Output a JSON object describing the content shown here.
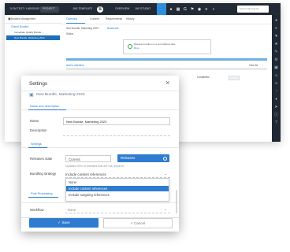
{
  "app": {
    "topbar": {
      "project_selector": "JLCM TEST / LABS/1100",
      "menu_label": "PROJECT",
      "env_label": "JAS-TEMPLATE",
      "user_initial": "S",
      "tab_overview": "OVERVIEW",
      "tab_jam": "JAS STUDIO",
      "search_placeholder": "Search all projects"
    },
    "sidebar": {
      "title": "Bundles Management",
      "section": "ClientA Bundles",
      "items": [
        {
          "label": "Immediate Quality Bundle ..."
        },
        {
          "label": "New Bundle, Marketing 2023"
        }
      ]
    },
    "content": {
      "tabs": [
        "Overview",
        "Content",
        "Requirements",
        "History"
      ],
      "breadcrumb": "New Bundle, Marketing 2023",
      "breadcrumb_action": "Bookmark",
      "status_label": "Status",
      "info_line1": "Releases bundle is in a non-finalized state",
      "info_line2": "More",
      "add_label": "Add to selection",
      "row_label": "Target Product",
      "row_status": "Completed",
      "view_all": "View All"
    }
  },
  "dialog": {
    "title": "Settings",
    "subtitle": "New Bundle, Marketing 2023",
    "section_name": "Name and description",
    "name_label": "Name",
    "name_value": "New Bundle, Marketing 2023",
    "description_label": "Description",
    "section_settings": "Settings",
    "releases_state_label": "Releases state",
    "releases_option_current": "Current",
    "releases_option_releases": "Releases",
    "releases_hint": "Updated 40% of releases that are not required",
    "bundling_label": "Bundling strategy",
    "bundling_value": "Include content references",
    "bundling_options": [
      {
        "label": "None"
      },
      {
        "label": "Include content references"
      },
      {
        "label": "Include outgoing references"
      }
    ],
    "section_post_processing": "Post Processing",
    "workflow_label": "Workflow",
    "workflow_value": "- None -",
    "save_label": "Save",
    "cancel_label": "Cancel"
  }
}
